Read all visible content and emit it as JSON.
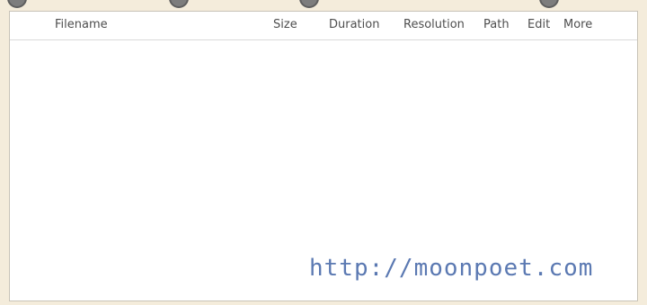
{
  "table": {
    "columns": {
      "filename": "Filename",
      "size": "Size",
      "duration": "Duration",
      "resolution": "Resolution",
      "path": "Path",
      "edit": "Edit",
      "more": "More"
    },
    "rows": []
  },
  "watermark": {
    "text": "http://moonpoet.com"
  },
  "colors": {
    "background": "#f4ecdb",
    "panel": "#ffffff",
    "header_text": "#4e4e4e",
    "watermark": "#5b79b2",
    "top_buttons": "#7d7d7d"
  },
  "toolbar": {
    "buttons": [
      {
        "icon": "circle-button-icon"
      },
      {
        "icon": "circle-button-icon"
      },
      {
        "icon": "circle-button-icon"
      },
      {
        "icon": "circle-button-icon"
      }
    ]
  }
}
